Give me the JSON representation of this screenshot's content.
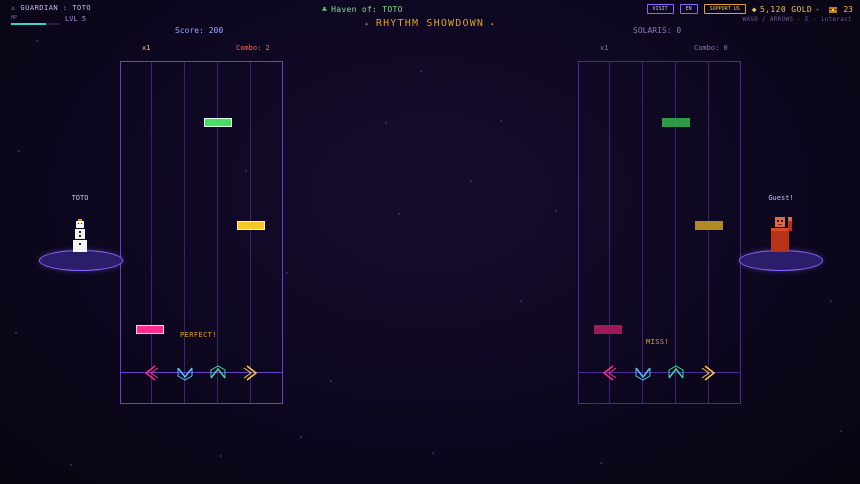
{
  "hud": {
    "guardian_label": "⚔ GUARDIAN : TOTO",
    "hp_label": "HP",
    "hp_fraction": 0.72,
    "level": "LVL 5"
  },
  "haven": {
    "icon": "sprout-icon",
    "label": "Haven of: TOTO"
  },
  "title": {
    "spark": "✦",
    "text": "RHYTHM SHOWDOWN"
  },
  "top_right": {
    "visit_label": "VISIT",
    "lang_label": "EN",
    "support_label": "SUPPORT US",
    "gold_icon": "gem-icon",
    "gold_text": "5,120 GOLD",
    "separator": "-",
    "chest_icon": "chest-icon",
    "chest_count": "23",
    "hint": "WASD / ARROWS - E - interact"
  },
  "left_player": {
    "score": "Score: 200",
    "multiplier": "x1",
    "combo": "Combo: 2",
    "name": "TOTO",
    "judgement": "PERFECT!"
  },
  "right_player": {
    "score": "SOLARIS: 0",
    "multiplier": "x1",
    "combo": "Combo: 0",
    "name": "Guest!",
    "judgement": "MISS!"
  },
  "colors": {
    "left": "#ff2d8a",
    "down": "#4fc3f7",
    "up": "#3fd3a0",
    "right": "#ffcc33",
    "note_green": "#4cdc6a",
    "note_green_dim": "#2e9a48",
    "note_yellow": "#f6c825",
    "note_yellow_dim": "#b08a22",
    "note_pink": "#ff2d8a",
    "note_pink_dim": "#a01a5a"
  }
}
